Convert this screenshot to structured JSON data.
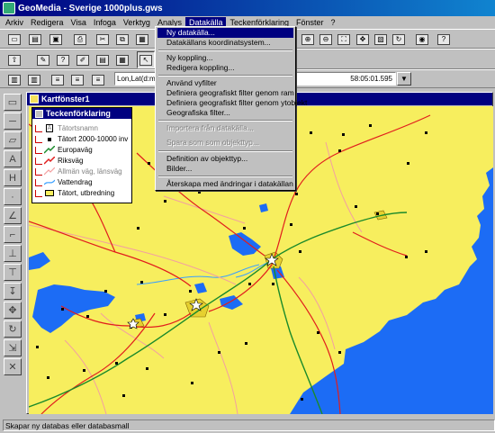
{
  "window": {
    "title": "GeoMedia - Sverige 1000plus.gws"
  },
  "menubar": {
    "items": [
      {
        "label": "Arkiv"
      },
      {
        "label": "Redigera"
      },
      {
        "label": "Visa"
      },
      {
        "label": "Infoga"
      },
      {
        "label": "Verktyg"
      },
      {
        "label": "Analys"
      },
      {
        "label": "Datakälla"
      },
      {
        "label": "Teckenförklaring"
      },
      {
        "label": "Fönster"
      },
      {
        "label": "?"
      }
    ],
    "active": "Datakälla"
  },
  "coordinates": {
    "format_label": "Lon,Lat(d:m:s)",
    "value": "58:05:01.595"
  },
  "map_window": {
    "title": "Kartfönster1"
  },
  "legend": {
    "title": "Teckenförklaring",
    "entries": [
      {
        "label": "Tätortsnamn",
        "symbol": "text",
        "greyed": true
      },
      {
        "label": "Tätort 2000-10000 inv",
        "symbol": "point",
        "greyed": false
      },
      {
        "label": "Europaväg",
        "symbol": "line-green",
        "greyed": false
      },
      {
        "label": "Riksväg",
        "symbol": "line-red",
        "greyed": false
      },
      {
        "label": "Allmän väg, länsväg",
        "symbol": "line-pink",
        "greyed": true
      },
      {
        "label": "Vattendrag",
        "symbol": "line-blue",
        "greyed": false
      },
      {
        "label": "Tätort, utbredning",
        "symbol": "area-yellow",
        "greyed": false
      }
    ]
  },
  "dropdown": {
    "items": [
      {
        "label": "Ny datakälla...",
        "highlight": true,
        "disabled": false
      },
      {
        "label": "Datakällans koordinatsystem...",
        "highlight": false,
        "disabled": false
      },
      {
        "separator": true
      },
      {
        "label": "Ny koppling...",
        "highlight": false,
        "disabled": false
      },
      {
        "label": "Redigera koppling...",
        "highlight": false,
        "disabled": false
      },
      {
        "separator": true
      },
      {
        "label": "Använd vyfilter",
        "highlight": false,
        "disabled": false
      },
      {
        "label": "Definiera geografiskt filter genom ram",
        "highlight": false,
        "disabled": false
      },
      {
        "label": "Definiera geografiskt filter genom ytobjekt",
        "highlight": false,
        "disabled": false
      },
      {
        "label": "Geografiska filter...",
        "highlight": false,
        "disabled": false
      },
      {
        "separator": true
      },
      {
        "label": "Importera från datakälla...",
        "highlight": false,
        "disabled": true
      },
      {
        "label": "Spara som som objekttyp...",
        "highlight": false,
        "disabled": true
      },
      {
        "separator": true
      },
      {
        "label": "Definition av objekttyp...",
        "highlight": false,
        "disabled": false
      },
      {
        "label": "Bilder...",
        "highlight": false,
        "disabled": false
      },
      {
        "separator": true
      },
      {
        "label": "Återskapa med ändringar i datakällan",
        "highlight": false,
        "disabled": false
      }
    ]
  },
  "statusbar": {
    "text": "Skapar ny databas eller databasmall"
  },
  "colors": {
    "land": "#f7ee5e",
    "water": "#1c6cf5",
    "europavag": "#1a8a2a",
    "riksvag": "#e11d1d",
    "lansvag": "#f3a0a0",
    "vattendrag": "#3aa0ff",
    "titlebar": "#000080"
  }
}
